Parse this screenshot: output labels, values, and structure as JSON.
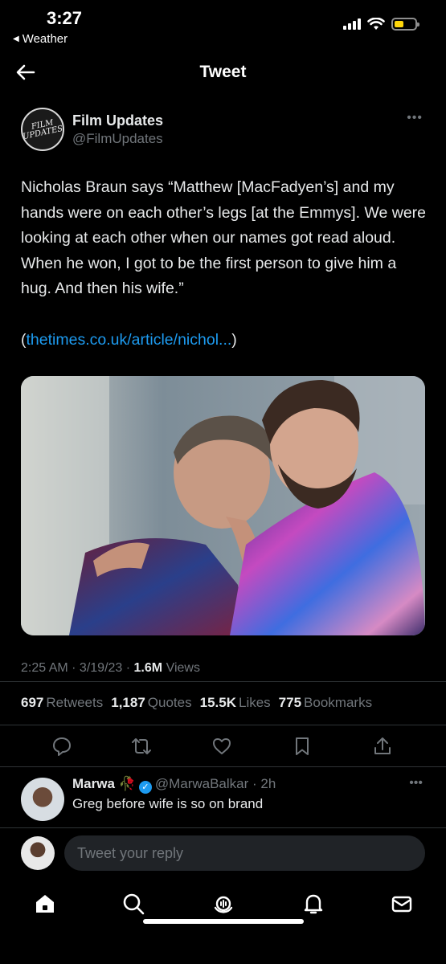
{
  "status_bar": {
    "time": "3:27",
    "back_app": "Weather",
    "battery_color": "#ffd60a"
  },
  "header": {
    "title": "Tweet",
    "back_icon": "back-arrow-icon"
  },
  "tweet": {
    "author_name": "Film Updates",
    "author_handle": "@FilmUpdates",
    "avatar_text_line1": "FILM",
    "avatar_text_line2": "UPDATES",
    "text": "Nicholas Braun says “Matthew [MacFadyen’s] and my hands were on each other’s legs [at the Emmys]. We were looking at each other when our names got read aloud. When he won, I got to be the first person to give him a hug. And then his wife.”",
    "link_open": "(",
    "link_text": "thetimes.co.uk/article/nichol...",
    "link_close": ")",
    "time": "2:25 AM",
    "date": "3/19/23",
    "views_count": "1.6M",
    "views_label": "Views",
    "more_icon": "more-dots-icon"
  },
  "stats": [
    {
      "count": "697",
      "label": "Retweets"
    },
    {
      "count": "1,187",
      "label": "Quotes"
    },
    {
      "count": "15.5K",
      "label": "Likes"
    },
    {
      "count": "775",
      "label": "Bookmarks"
    }
  ],
  "actions": [
    "reply-icon",
    "retweet-icon",
    "like-icon",
    "bookmark-icon",
    "share-icon"
  ],
  "reply": {
    "name": "Marwa",
    "handle": "@MarwaBalkar",
    "time": "2h",
    "text": "Greg before wife is so on brand"
  },
  "compose": {
    "placeholder": "Tweet your reply"
  },
  "tabbar": [
    "home-icon",
    "search-icon",
    "spaces-icon",
    "notifications-icon",
    "messages-icon"
  ],
  "colors": {
    "accent": "#1d9bf0",
    "text_primary": "#e7e9ea",
    "text_secondary": "#71767b",
    "background": "#000000"
  }
}
